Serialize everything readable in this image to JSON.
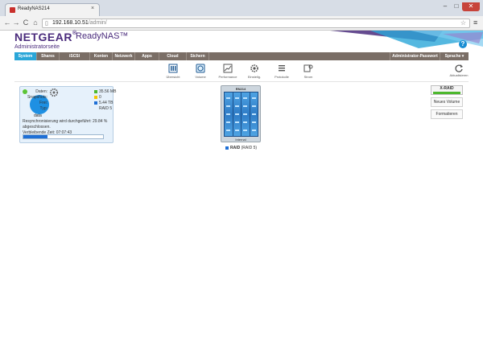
{
  "browser": {
    "tab_title": "ReadyNAS214",
    "tab_close": "×",
    "url": "192.168.10.51/admin/",
    "url_host": "192.168.10.51",
    "url_path": "/admin/",
    "buttons": {
      "back": "←",
      "forward": "→",
      "reload": "C",
      "home": "⌂",
      "star": "☆",
      "menu": "≡"
    },
    "window": {
      "minimize": "–",
      "maximize": "□",
      "close": "✕"
    }
  },
  "header": {
    "brand": "NETGEAR",
    "brand_mark": "®",
    "product": "ReadyNAS™",
    "subtitle": "Administratorseite",
    "help": "?"
  },
  "nav": {
    "items": [
      {
        "label": "System",
        "active": true
      },
      {
        "label": "Shares"
      },
      {
        "label": "iSCSI"
      },
      {
        "label": "Konten"
      },
      {
        "label": "Netzwerk"
      },
      {
        "label": "Apps"
      },
      {
        "label": "Cloud"
      },
      {
        "label": "Sichern"
      }
    ],
    "admin_password": "Administrator-Passwort",
    "language": "Sprache ▾"
  },
  "subnav": {
    "items": [
      {
        "label": "Übersicht",
        "icon": "overview-icon"
      },
      {
        "label": "Volume",
        "icon": "volume-icon",
        "active": true
      },
      {
        "label": "Performance",
        "icon": "performance-icon"
      },
      {
        "label": "Einstellg.",
        "icon": "settings-icon"
      },
      {
        "label": "Protokolle",
        "icon": "logs-icon"
      },
      {
        "label": "Strom",
        "icon": "power-icon"
      }
    ],
    "refresh": "Aktualisieren"
  },
  "volume": {
    "name": "data",
    "stats": [
      {
        "key": "Daten:",
        "value": "35.56 MB",
        "color": "#4db82e"
      },
      {
        "key": "Snapshots:",
        "value": "0",
        "color": "#f5c400"
      },
      {
        "key": "Frei:",
        "value": "5.44 TB",
        "color": "#1e6fd6"
      },
      {
        "key": "Typ:",
        "value": "RAID 5",
        "color": ""
      }
    ],
    "resync_text": "Resynchronisierung wird durchgeführt: 29.84 % abgeschlossen.",
    "remaining": "Verbleibende Zeit: 07:07:43",
    "progress_fraction": 0.2984
  },
  "device": {
    "name": "RN214",
    "label": "Internal",
    "raid_name": "RAID",
    "raid_type": "(RAID 5)"
  },
  "side_buttons": {
    "xraid": "X-RAID",
    "new_volume": "Neues Volume",
    "format": "Formatieren"
  },
  "colors": {
    "brand": "#4a2b7c",
    "accent": "#2aa6d8",
    "navbar": "#7a6e66",
    "ok": "#5cc436"
  }
}
